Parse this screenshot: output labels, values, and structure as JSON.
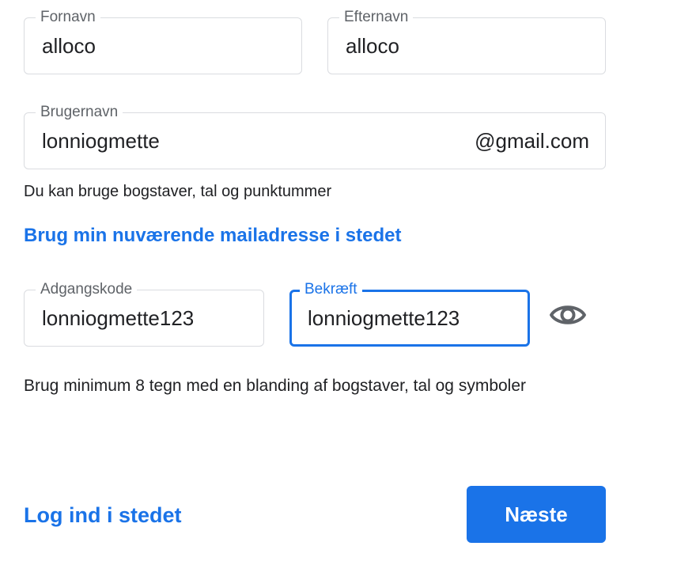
{
  "form": {
    "first_name": {
      "label": "Fornavn",
      "value": "alloco"
    },
    "last_name": {
      "label": "Efternavn",
      "value": "alloco"
    },
    "username": {
      "label": "Brugernavn",
      "value": "lonniogmette",
      "suffix": "@gmail.com",
      "helper": "Du kan bruge bogstaver, tal og punktummer"
    },
    "use_current_email_link": "Brug min nuværende mailadresse i stedet",
    "password": {
      "label": "Adgangskode",
      "value": "lonniogmette123"
    },
    "confirm": {
      "label": "Bekræft",
      "value": "lonniogmette123",
      "focused": true
    },
    "show_password_icon": "eye-icon",
    "password_helper": "Brug minimum 8 tegn med en blanding af bogstaver, tal og symboler"
  },
  "footer": {
    "sign_in_link": "Log ind i stedet",
    "next_button": "Næste"
  },
  "colors": {
    "accent": "#1a73e8",
    "border": "#dadce0",
    "label": "#5f6368",
    "text": "#202124"
  }
}
